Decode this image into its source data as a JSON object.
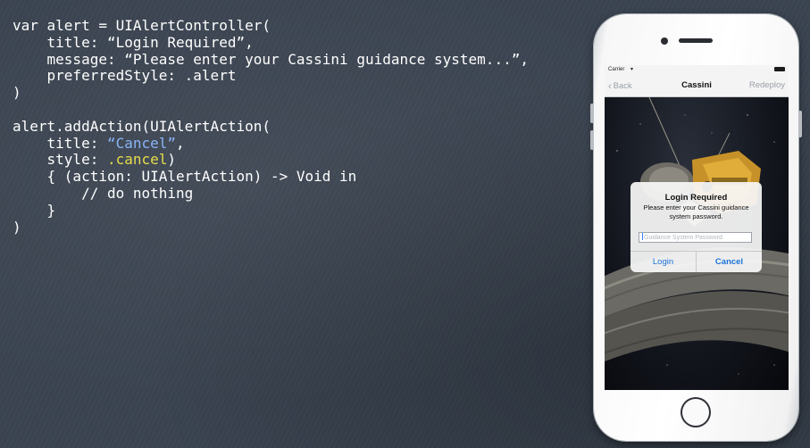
{
  "code": {
    "lines": [
      [
        {
          "t": "var alert = UIAlertController("
        }
      ],
      [
        {
          "t": "    title: "
        },
        {
          "t": "“Login Required”,"
        }
      ],
      [
        {
          "t": "    message: “Please enter your Cassini guidance system...”,"
        }
      ],
      [
        {
          "t": "    preferredStyle: .alert"
        }
      ],
      [
        {
          "t": ")"
        }
      ],
      [
        {
          "t": ""
        }
      ],
      [
        {
          "t": "alert.addAction(UIAlertAction("
        }
      ],
      [
        {
          "t": "    title: "
        },
        {
          "t": "“Cancel”",
          "c": "str"
        },
        {
          "t": ","
        }
      ],
      [
        {
          "t": "    style: "
        },
        {
          "t": ".cancel",
          "c": "kw"
        },
        {
          "t": ")"
        }
      ],
      [
        {
          "t": "    { (action: UIAlertAction) -> Void in"
        }
      ],
      [
        {
          "t": "        // do nothing"
        }
      ],
      [
        {
          "t": "    }"
        }
      ],
      [
        {
          "t": ")"
        }
      ]
    ]
  },
  "phone": {
    "status": {
      "carrier": "Carrier",
      "wifi": "wifi-icon",
      "battery": "battery-icon"
    },
    "navbar": {
      "back": "Back",
      "title": "Cassini",
      "right": "Redeploy"
    },
    "alert": {
      "title": "Login Required",
      "message": "Please enter your Cassini guidance system password.",
      "placeholder": "Guidance System Password",
      "login": "Login",
      "cancel": "Cancel"
    }
  },
  "colors": {
    "background": "#3a4350",
    "code_text": "#ffffff",
    "string_literal": "#8ab4f8",
    "keyword": "#e6dc4a",
    "ios_tint": "#1a73d9"
  }
}
